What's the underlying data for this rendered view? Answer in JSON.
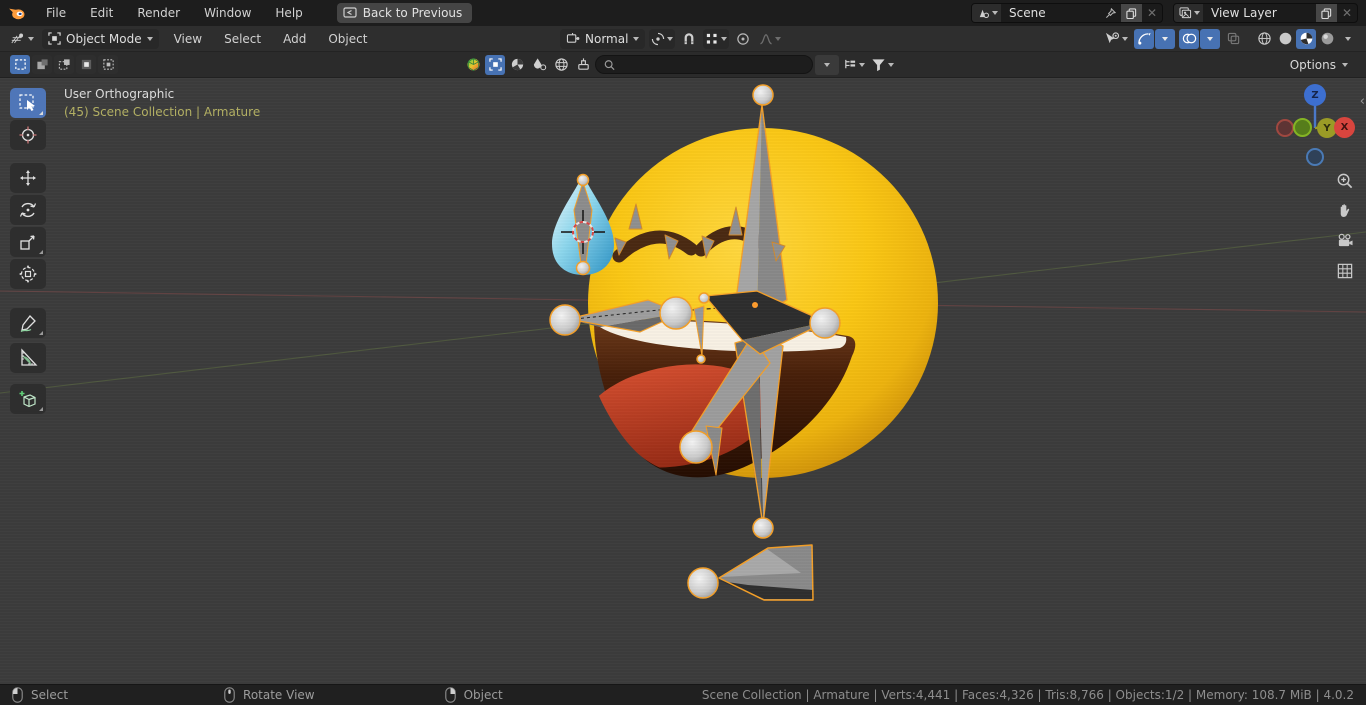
{
  "topbar": {
    "menus": [
      "File",
      "Edit",
      "Render",
      "Window",
      "Help"
    ],
    "back_button": "Back to Previous",
    "scene_value": "Scene",
    "view_layer_value": "View Layer"
  },
  "header": {
    "mode": "Object Mode",
    "menus": [
      "View",
      "Select",
      "Add",
      "Object"
    ],
    "orientation": "Normal"
  },
  "tools_row": {
    "options": "Options",
    "search_placeholder": ""
  },
  "viewport": {
    "view_label": "User Orthographic",
    "context_label": "(45) Scene Collection | Armature",
    "axis_z": "Z",
    "axis_y": "Y",
    "axis_x": "X"
  },
  "status": {
    "hint_left": "Select",
    "hint_middle": "Rotate View",
    "hint_right": "Object",
    "stats": "Scene Collection | Armature | Verts:4,441 | Faces:4,326 | Tris:8,766 | Objects:1/2 | Memory: 108.7 MiB | 4.0.2"
  },
  "colors": {
    "accent_blue": "#4772b3",
    "bone_selected_outline": "#f5a028",
    "context_text": "#b2af63",
    "emoji_yellow": "#fac714",
    "tear_blue": "#7fcfe9",
    "axis_x_line": "#8a4a4a",
    "axis_y_line": "#5f7042"
  }
}
